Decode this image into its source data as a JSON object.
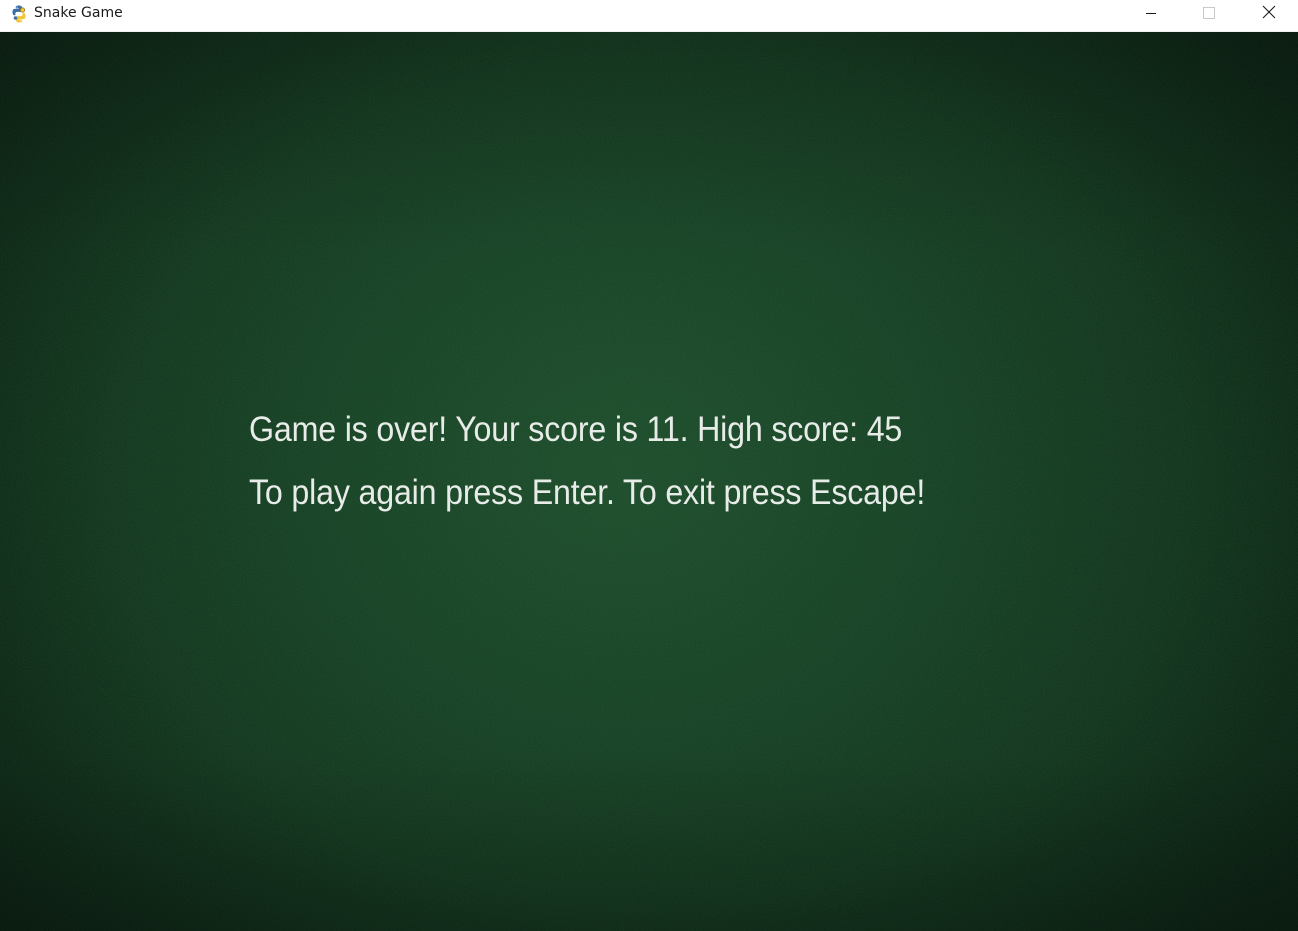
{
  "window": {
    "title": "Snake Game",
    "app_icon": "python-icon"
  },
  "controls": {
    "minimize_icon": "minimize-icon",
    "maximize_icon": "maximize-icon",
    "close_icon": "close-icon"
  },
  "game": {
    "state": "game-over",
    "score": 11,
    "high_score": 45,
    "message_line1": "Game is over! Your score is 11. High score: 45",
    "message_line2": "To play again press Enter. To exit press Escape!",
    "background_color": "#163e23",
    "text_color": "#e8ece8"
  }
}
